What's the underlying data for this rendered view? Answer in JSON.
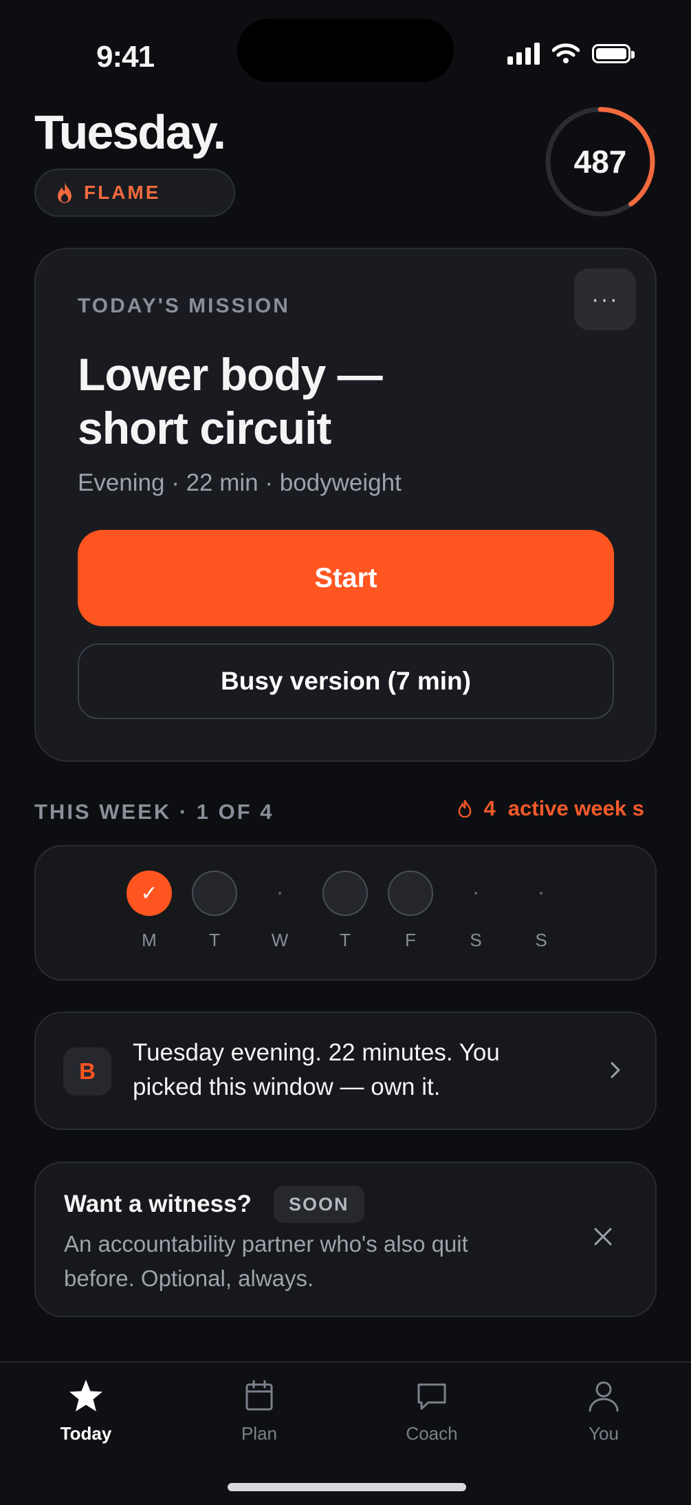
{
  "status_bar": {
    "time": "9:41",
    "icons": [
      "signal-icon",
      "wifi-icon",
      "battery-icon"
    ]
  },
  "header": {
    "day": "Tuesday.",
    "badge_label": "FLAME",
    "badge_icon": "flame-icon",
    "score": "487",
    "score_progress": 0.4
  },
  "mission": {
    "kicker": "TODAY'S MISSION",
    "title": "Lower body — short circuit",
    "subtitle": "Evening · 22 min · bodyweight",
    "start_label": "Start",
    "busy_label": "Busy version (7 min)",
    "more_icon": "more-icon"
  },
  "week": {
    "label": "THIS WEEK · 1 OF 4",
    "streak_count": "4",
    "streak_label": "active week s",
    "days": [
      {
        "letter": "M",
        "state": "done"
      },
      {
        "letter": "T",
        "state": "planned"
      },
      {
        "letter": "W",
        "state": "rest"
      },
      {
        "letter": "T",
        "state": "planned"
      },
      {
        "letter": "F",
        "state": "planned"
      },
      {
        "letter": "S",
        "state": "rest"
      },
      {
        "letter": "S",
        "state": "rest"
      }
    ]
  },
  "coach": {
    "avatar_letter": "B",
    "message": "Tuesday evening. 22 minutes. You picked this window — own it."
  },
  "witness": {
    "title": "Want a witness?",
    "badge": "SOON",
    "text": "An accountability partner who's also quit before. Optional, always."
  },
  "tabs": [
    {
      "label": "Today",
      "icon": "star-icon",
      "active": true
    },
    {
      "label": "Plan",
      "icon": "calendar-icon",
      "active": false
    },
    {
      "label": "Coach",
      "icon": "chat-icon",
      "active": false
    },
    {
      "label": "You",
      "icon": "person-icon",
      "active": false
    }
  ],
  "colors": {
    "accent": "#ff5520",
    "background": "#0d0e11",
    "card": "#1a1b20"
  }
}
